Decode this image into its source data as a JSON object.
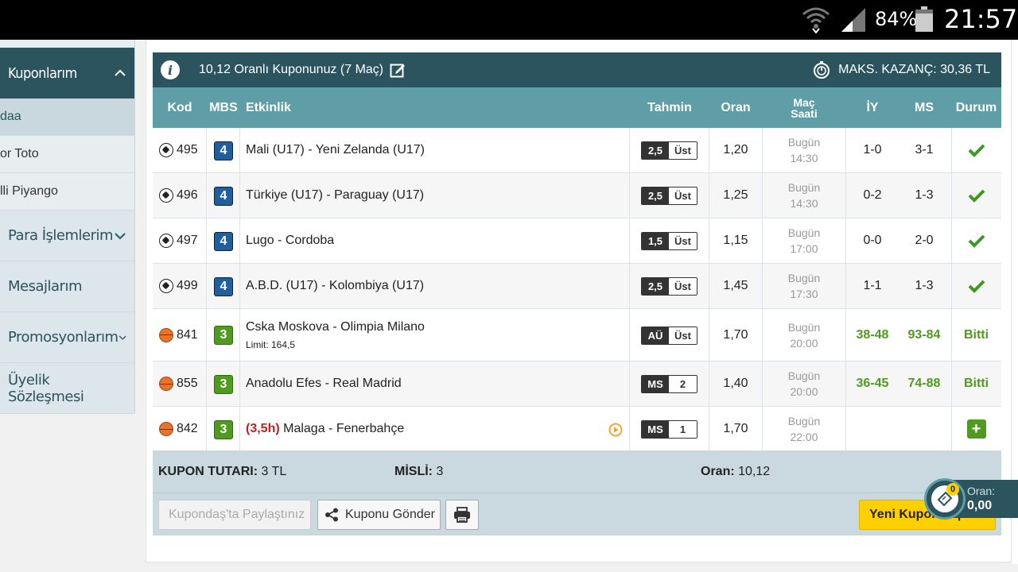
{
  "status_bar": {
    "battery": "84%",
    "time": "21:57"
  },
  "sidebar": {
    "header": "Kuponlarım",
    "sub_items": [
      "daa",
      "or Toto",
      "lli Piyango"
    ],
    "menu_items": [
      {
        "label": "Para İşlemlerim",
        "has_chevron": true
      },
      {
        "label": "Mesajlarım",
        "has_chevron": false
      },
      {
        "label": "Promosyonlarım",
        "has_chevron": true
      },
      {
        "label": "Üyelik Sözleşmesi",
        "has_chevron": false
      }
    ]
  },
  "coupon": {
    "title": "10,12 Oranlı Kuponunuz (7 Maç)",
    "max_win": "MAKS. KAZANÇ: 30,36 TL"
  },
  "table": {
    "headers": {
      "kod": "Kod",
      "mbs": "MBS",
      "etkinlik": "Etkinlik",
      "tahmin": "Tahmin",
      "oran": "Oran",
      "mac_line1": "Maç",
      "mac_line2": "Saati",
      "iy": "İY",
      "ms": "MS",
      "durum": "Durum"
    },
    "rows": [
      {
        "sport": "soccer",
        "kod": "495",
        "mbs": "4",
        "event": "Mali (U17) - Yeni Zelanda (U17)",
        "tahmin_l": "2,5",
        "tahmin_r": "Üst",
        "oran": "1,20",
        "day": "Bugün",
        "time": "14:30",
        "iy": "1-0",
        "ms": "3-1",
        "durum": "check"
      },
      {
        "sport": "soccer",
        "kod": "496",
        "mbs": "4",
        "event": "Türkiye (U17) - Paraguay (U17)",
        "tahmin_l": "2,5",
        "tahmin_r": "Üst",
        "oran": "1,25",
        "day": "Bugün",
        "time": "14:30",
        "iy": "0-2",
        "ms": "1-3",
        "durum": "check"
      },
      {
        "sport": "soccer",
        "kod": "497",
        "mbs": "4",
        "event": "Lugo - Cordoba",
        "tahmin_l": "1,5",
        "tahmin_r": "Üst",
        "oran": "1,15",
        "day": "Bugün",
        "time": "17:00",
        "iy": "0-0",
        "ms": "2-0",
        "durum": "check"
      },
      {
        "sport": "soccer",
        "kod": "499",
        "mbs": "4",
        "event": "A.B.D. (U17) - Kolombiya (U17)",
        "tahmin_l": "2,5",
        "tahmin_r": "Üst",
        "oran": "1,45",
        "day": "Bugün",
        "time": "17:30",
        "iy": "1-1",
        "ms": "1-3",
        "durum": "check"
      },
      {
        "sport": "basket",
        "kod": "841",
        "mbs": "3",
        "event": "Cska Moskova - Olimpia Milano",
        "limit": "Limit: 164,5",
        "tahmin_l": "AÜ",
        "tahmin_r": "Üst",
        "oran": "1,70",
        "day": "Bugün",
        "time": "20:00",
        "iy": "38-48",
        "ms": "93-84",
        "durum": "Bitti"
      },
      {
        "sport": "basket",
        "kod": "855",
        "mbs": "3",
        "event": "Anadolu Efes - Real Madrid",
        "tahmin_l": "MS",
        "tahmin_r": "2",
        "oran": "1,40",
        "day": "Bugün",
        "time": "20:00",
        "iy": "36-45",
        "ms": "74-88",
        "durum": "Bitti"
      },
      {
        "sport": "basket",
        "kod": "842",
        "mbs": "3",
        "prefix": "(3,5h)",
        "event": "Malaga - Fenerbahçe",
        "tahmin_l": "MS",
        "tahmin_r": "1",
        "oran": "1,70",
        "day": "Bugün",
        "time": "22:00",
        "iy": "",
        "ms": "",
        "durum": "plus",
        "live": true
      }
    ]
  },
  "summary": {
    "tutar_label": "KUPON TUTARI:",
    "tutar_value": "3 TL",
    "misli_label": "MİSLİ:",
    "misli_value": "3",
    "oran_label": "Oran:",
    "oran_value": "10,12"
  },
  "actions": {
    "share_kupondas": "Kupondaş'ta Paylaştınız",
    "send": "Kuponu Gönder",
    "new_coupon": "Yeni Kupon Yap"
  },
  "floating": {
    "badge": "0",
    "label": "Oran:",
    "value": "0,00"
  }
}
